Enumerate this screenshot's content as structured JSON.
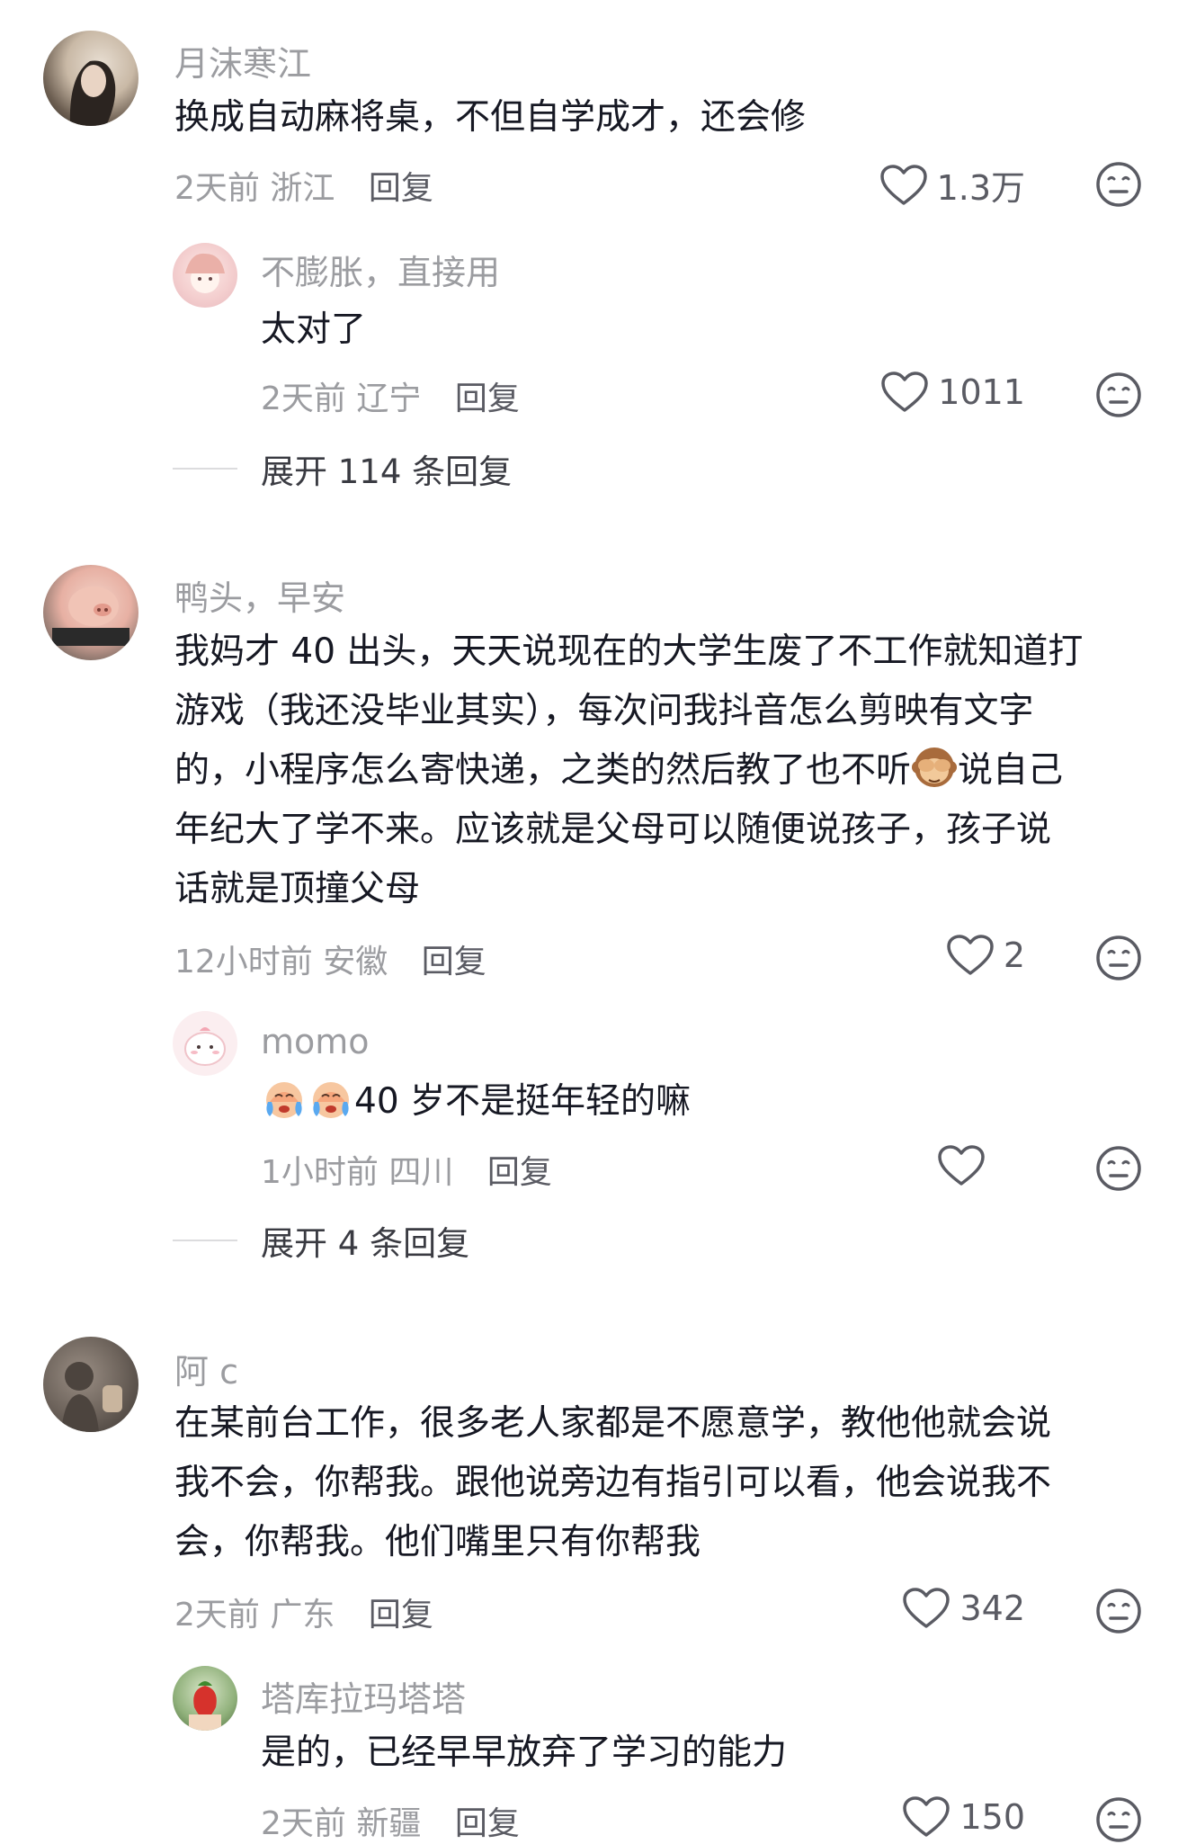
{
  "comments": [
    {
      "username": "月沫寒江",
      "text_lines": [
        "换成自动麻将桌，不但自学成才，还会修"
      ],
      "time": "2天前",
      "location": "浙江",
      "reply_label": "回复",
      "likes": "1.3万",
      "replies": [
        {
          "username": "不膨胀，直接用",
          "text": "太对了",
          "time": "2天前",
          "location": "辽宁",
          "reply_label": "回复",
          "likes": "1011"
        }
      ],
      "expand_label": "展开 114 条回复"
    },
    {
      "username": "鸭头，早安",
      "text_lines": [
        "我妈才 40 出头，天天说现在的大学生废了不工作就知道打",
        "游戏（我还没毕业其实），每次问我抖音怎么剪映有文字",
        "的，小程序怎么寄快递，之类的然后教了也不听",
        "说自己",
        "年纪大了学不来。应该就是父母可以随便说孩子，孩子说",
        "话就是顶撞父母"
      ],
      "time": "12小时前",
      "location": "安徽",
      "reply_label": "回复",
      "likes": "2",
      "replies": [
        {
          "username": "momo",
          "text": "40 岁不是挺年轻的嘛",
          "time": "1小时前",
          "location": "四川",
          "reply_label": "回复",
          "likes": ""
        }
      ],
      "expand_label": "展开 4 条回复"
    },
    {
      "username": "阿 c",
      "text_lines": [
        "在某前台工作，很多老人家都是不愿意学，教他他就会说",
        "我不会，你帮我。跟他说旁边有指引可以看，他会说我不",
        "会，你帮我。他们嘴里只有你帮我"
      ],
      "time": "2天前",
      "location": "广东",
      "reply_label": "回复",
      "likes": "342",
      "replies": [
        {
          "username": "塔库拉玛塔塔",
          "text": "是的，已经早早放弃了学习的能力",
          "time": "2天前",
          "location": "新疆",
          "reply_label": "回复",
          "likes": "150"
        }
      ]
    }
  ],
  "icons": {
    "like": "heart-outline-icon",
    "dislike": "meh-face-icon",
    "see_no_evil": "see-no-evil-monkey-emoji",
    "crying": "crying-face-emoji"
  },
  "colors": {
    "username": "#9b9ca0",
    "text": "#161823",
    "meta": "#9b9ca0",
    "reply": "#5a5b63"
  }
}
